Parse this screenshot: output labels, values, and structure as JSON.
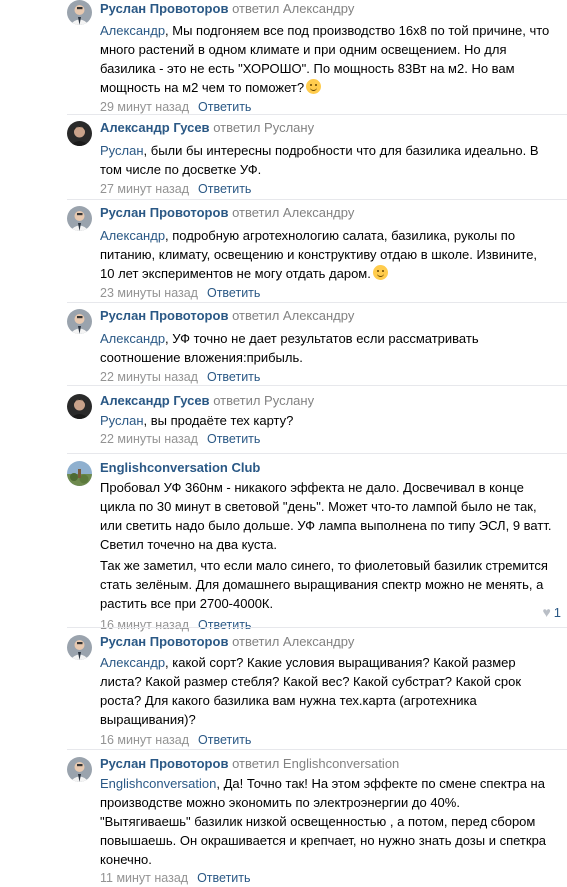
{
  "comments": [
    {
      "author": "Руслан Провоторов",
      "replied_to": "ответил Александру",
      "mention": "Александр",
      "text": ", Мы подгоняем все под производство 16х8 по той причине, что много растений в одном климате и при одним освещением. Но для базилика - это не есть \"ХОРОШО\". По мощность 83Вт на м2. Но вам мощность на м2 чем то поможет?",
      "time": "29 минут назад",
      "reply": "Ответить",
      "avatar": "ruslan"
    },
    {
      "author": "Александр Гусев",
      "replied_to": "ответил Руслану",
      "mention": "Руслан",
      "text": ", были бы интересны подробности что для базилика идеально. В том числе по досветке УФ.",
      "time": "27 минут назад",
      "reply": "Ответить",
      "avatar": "alexander"
    },
    {
      "author": "Руслан Провоторов",
      "replied_to": "ответил Александру",
      "mention": "Александр",
      "text": ", подробную агротехнологию салата, базилика, руколы по питанию, климату, освещению и конструктиву отдаю в школе. Извините, 10 лет экспериментов не могу отдать даром.",
      "time": "23 минуты назад",
      "reply": "Ответить",
      "avatar": "ruslan"
    },
    {
      "author": "Руслан Провоторов",
      "replied_to": "ответил Александру",
      "mention": "Александр",
      "text": ", УФ точно не дает результатов если рассматривать соотношение вложения:прибыль.",
      "time": "22 минуты назад",
      "reply": "Ответить",
      "avatar": "ruslan"
    },
    {
      "author": "Александр Гусев",
      "replied_to": "ответил Руслану",
      "mention": "Руслан",
      "text": ", вы продаёте тех карту?",
      "time": "22 минуты назад",
      "reply": "Ответить",
      "avatar": "alexander"
    },
    {
      "author": "Englishconversation Club",
      "replied_to": "",
      "mention": "",
      "text": "Пробовал УФ 360нм - никакого эффекта не дало. Досвечивал в конце цикла по 30 минут в световой \"день\". Может что-то лампой было не так, или светить надо было дольше. УФ лампа выполнена по типу ЭСЛ, 9 ватт. Светил точечно на два куста.",
      "text2": "Так же заметил, что если мало синего, то фиолетовый базилик стремится стать зелёным. Для домашнего выращивания спектр можно не менять, а растить все при 2700-4000К.",
      "time": "16 минут назад",
      "reply": "Ответить",
      "likes": "1",
      "avatar": "club"
    },
    {
      "author": "Руслан Провоторов",
      "replied_to": "ответил Александру",
      "mention": "Александр",
      "text": ", какой сорт? Какие условия выращивания? Какой размер листа? Какой размер стебля? Какой вес? Какой субстрат? Какой срок роста? Для какого базилика вам нужна тех.карта (агротехника выращивания)?",
      "time": "16 минут назад",
      "reply": "Ответить",
      "avatar": "ruslan"
    },
    {
      "author": "Руслан Провоторов",
      "replied_to": "ответил Englishconversation",
      "mention": "Englishconversation",
      "text": ", Да! Точно так! На этом эффекте по смене спектра на производстве можно экономить по электроэнергии до 40%. \"Вытягиваешь\" базилик низкой освещенностью , а потом, перед сбором повышаешь. Он окрашивается и крепчает, но нужно знать дозы и спеткра конечно.",
      "time": "11 минут назад",
      "reply": "Ответить",
      "avatar": "ruslan"
    }
  ],
  "colors": {
    "link": "#2a5885",
    "meta": "#939393",
    "separator": "#e7e8ec"
  }
}
